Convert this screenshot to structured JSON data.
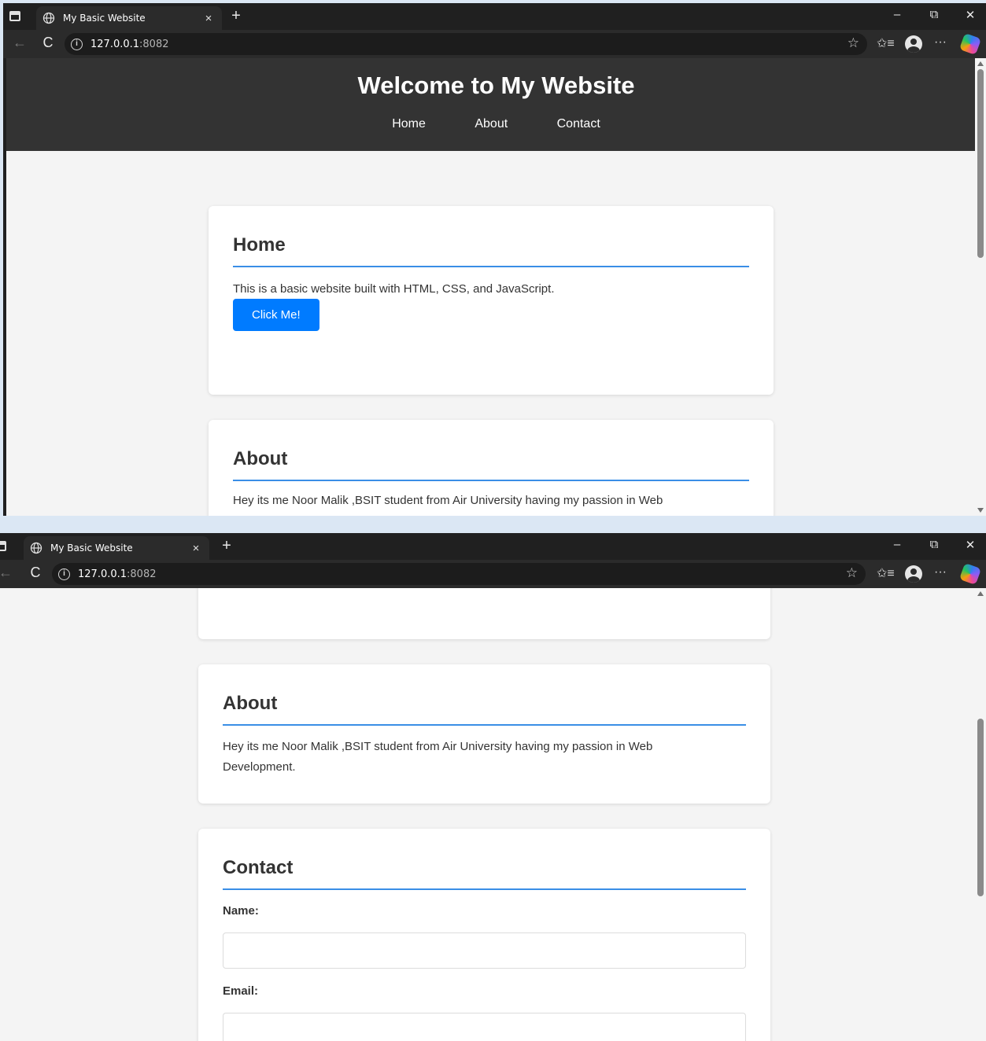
{
  "browser": {
    "tab_title": "My Basic Website",
    "tab_close": "×",
    "new_tab": "+",
    "url_host": "127.0.0.1",
    "url_port": ":8082",
    "back": "←",
    "reload": "C",
    "info": "i",
    "favorite": "☆",
    "favorites_list": "✩≡",
    "more": "···",
    "minimize": "–",
    "restore": "⧉",
    "close": "✕"
  },
  "site": {
    "title": "Welcome to My Website",
    "nav": [
      "Home",
      "About",
      "Contact"
    ]
  },
  "home": {
    "heading": "Home",
    "text": "This is a basic website built with HTML, CSS, and JavaScript.",
    "button_label": "Click Me!"
  },
  "about": {
    "heading": "About",
    "text": "Hey its me Noor Malik ,BSIT student from Air University having my passion in Web",
    "text_full": "Hey its me Noor Malik ,BSIT student from Air University having my passion in Web Development."
  },
  "contact": {
    "heading": "Contact",
    "name_label": "Name:",
    "email_label": "Email:"
  }
}
